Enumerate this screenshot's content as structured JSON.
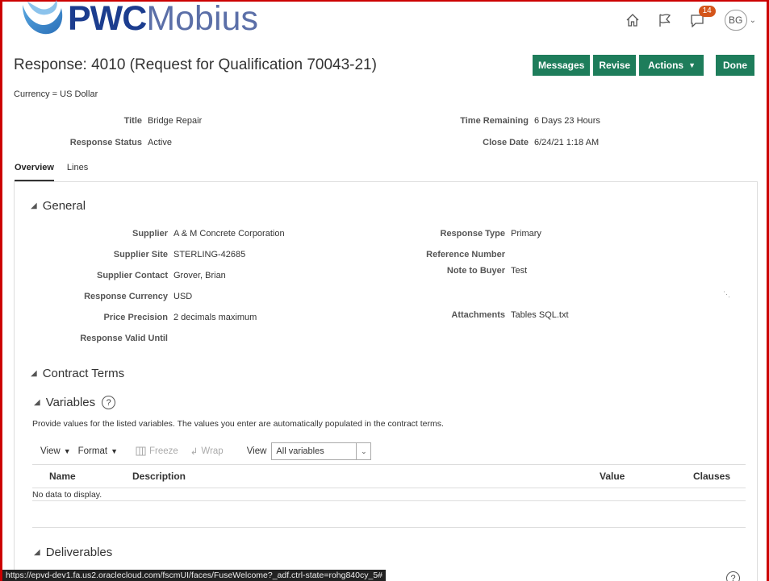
{
  "brand": {
    "bold": "PWC",
    "light": "Mobius"
  },
  "header": {
    "notifications_count": "14",
    "user_initials": "BG",
    "icons": [
      "home-icon",
      "flag-icon",
      "notifications-icon",
      "chevron-down-icon"
    ]
  },
  "page": {
    "title": "Response: 4010 (Request for Qualification 70043-21)",
    "currency": "Currency = US Dollar"
  },
  "buttons": {
    "messages": "Messages",
    "revise": "Revise",
    "actions": "Actions",
    "done": "Done"
  },
  "summary": {
    "title_label": "Title",
    "title_value": "Bridge Repair",
    "status_label": "Response Status",
    "status_value": "Active",
    "time_label": "Time Remaining",
    "time_value": "6 Days 23 Hours",
    "close_label": "Close Date",
    "close_value": "6/24/21 1:18 AM"
  },
  "tabs": [
    "Overview",
    "Lines"
  ],
  "general": {
    "heading": "General",
    "left": [
      {
        "label": "Supplier",
        "value": "A & M Concrete Corporation"
      },
      {
        "label": "Supplier Site",
        "value": "STERLING-42685"
      },
      {
        "label": "Supplier Contact",
        "value": "Grover, Brian"
      },
      {
        "label": "Response Currency",
        "value": "USD"
      },
      {
        "label": "Price Precision",
        "value": "2 decimals maximum"
      },
      {
        "label": "Response Valid Until",
        "value": ""
      }
    ],
    "right": [
      {
        "label": "Response Type",
        "value": "Primary"
      },
      {
        "label": "Reference Number",
        "value": ""
      },
      {
        "label": "Note to Buyer",
        "value": "Test"
      },
      {
        "label": "Attachments",
        "value": "Tables SQL.txt"
      }
    ]
  },
  "contract_terms": {
    "heading": "Contract Terms",
    "variables_heading": "Variables",
    "description": "Provide values for the listed variables. The values you enter are automatically populated in the contract terms.",
    "toolbar": {
      "view": "View",
      "format": "Format",
      "freeze": "Freeze",
      "wrap": "Wrap",
      "view_label": "View",
      "select_value": "All variables"
    },
    "columns": [
      "Name",
      "Description",
      "Value",
      "Clauses"
    ],
    "empty": "No data to display."
  },
  "deliverables": {
    "heading": "Deliverables"
  },
  "status_url": "https://epvd-dev1.fa.us2.oraclecloud.com/fscmUI/faces/FuseWelcome?_adf.ctrl-state=rohg840cy_5#"
}
